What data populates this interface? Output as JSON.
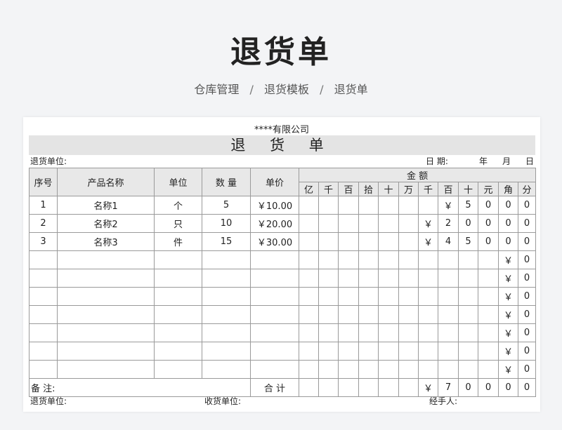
{
  "header": {
    "title": "退货单"
  },
  "breadcrumb": [
    "仓库管理",
    "/",
    "退货模板",
    "/",
    "退货单"
  ],
  "form": {
    "company": "****有限公司",
    "title": "退 货 单",
    "return_unit_label": "退货单位:",
    "date_label": "日 期:",
    "year": "年",
    "month": "月",
    "day": "日",
    "columns": {
      "seq": "序号",
      "name": "产品名称",
      "unit": "单位",
      "qty": "数 量",
      "price": "单价",
      "amount": "金 额"
    },
    "digit_headers": [
      "亿",
      "千",
      "百",
      "拾",
      "十",
      "万",
      "千",
      "百",
      "十",
      "元",
      "角",
      "分"
    ],
    "rows": [
      {
        "seq": "1",
        "name": "名称1",
        "unit": "个",
        "qty": "5",
        "price": "￥10.00",
        "digits": [
          "",
          "",
          "",
          "",
          "",
          "",
          "",
          "￥",
          "5",
          "0",
          "0",
          "0"
        ]
      },
      {
        "seq": "2",
        "name": "名称2",
        "unit": "只",
        "qty": "10",
        "price": "￥20.00",
        "digits": [
          "",
          "",
          "",
          "",
          "",
          "",
          "￥",
          "2",
          "0",
          "0",
          "0",
          "0"
        ]
      },
      {
        "seq": "3",
        "name": "名称3",
        "unit": "件",
        "qty": "15",
        "price": "￥30.00",
        "digits": [
          "",
          "",
          "",
          "",
          "",
          "",
          "￥",
          "4",
          "5",
          "0",
          "0",
          "0"
        ]
      },
      {
        "seq": "",
        "name": "",
        "unit": "",
        "qty": "",
        "price": "",
        "digits": [
          "",
          "",
          "",
          "",
          "",
          "",
          "",
          "",
          "",
          "",
          "￥",
          "0"
        ]
      },
      {
        "seq": "",
        "name": "",
        "unit": "",
        "qty": "",
        "price": "",
        "digits": [
          "",
          "",
          "",
          "",
          "",
          "",
          "",
          "",
          "",
          "",
          "￥",
          "0"
        ]
      },
      {
        "seq": "",
        "name": "",
        "unit": "",
        "qty": "",
        "price": "",
        "digits": [
          "",
          "",
          "",
          "",
          "",
          "",
          "",
          "",
          "",
          "",
          "￥",
          "0"
        ]
      },
      {
        "seq": "",
        "name": "",
        "unit": "",
        "qty": "",
        "price": "",
        "digits": [
          "",
          "",
          "",
          "",
          "",
          "",
          "",
          "",
          "",
          "",
          "￥",
          "0"
        ]
      },
      {
        "seq": "",
        "name": "",
        "unit": "",
        "qty": "",
        "price": "",
        "digits": [
          "",
          "",
          "",
          "",
          "",
          "",
          "",
          "",
          "",
          "",
          "￥",
          "0"
        ]
      },
      {
        "seq": "",
        "name": "",
        "unit": "",
        "qty": "",
        "price": "",
        "digits": [
          "",
          "",
          "",
          "",
          "",
          "",
          "",
          "",
          "",
          "",
          "￥",
          "0"
        ]
      },
      {
        "seq": "",
        "name": "",
        "unit": "",
        "qty": "",
        "price": "",
        "digits": [
          "",
          "",
          "",
          "",
          "",
          "",
          "",
          "",
          "",
          "",
          "￥",
          "0"
        ]
      }
    ],
    "remark_label": "备 注:",
    "total_label": "合 计",
    "total_digits": [
      "",
      "",
      "",
      "",
      "",
      "",
      "￥",
      "7",
      "0",
      "0",
      "0",
      "0"
    ],
    "footer": {
      "return_unit": "退货单位:",
      "receive_unit": "收货单位:",
      "handler": "经手人:"
    }
  }
}
